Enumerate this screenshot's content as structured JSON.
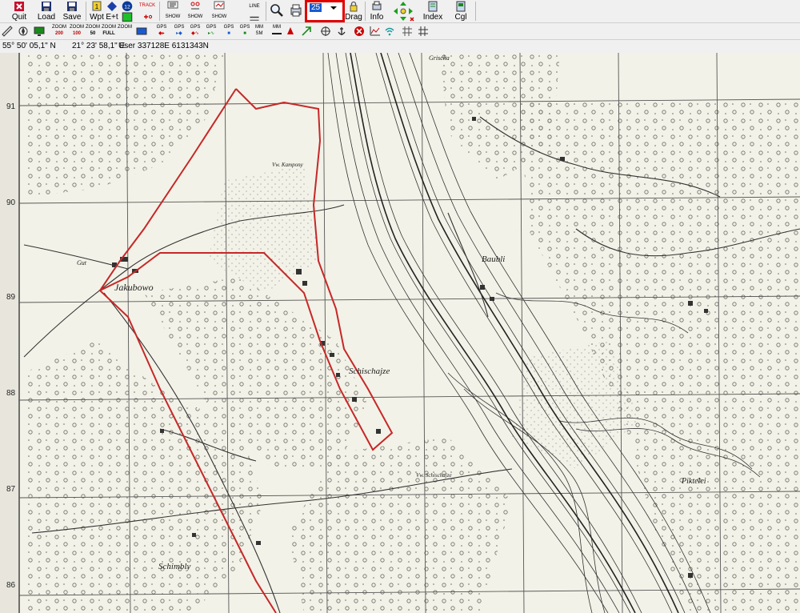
{
  "toolbar": {
    "quit": "Quit",
    "load": "Load",
    "save": "Save",
    "wpt": "Wpt",
    "ent": "E+t",
    "track": "TRACK",
    "show1": "SHOW",
    "show2": "SHOW",
    "show3": "SHOW",
    "line": "LINE",
    "drag": "Drag",
    "info": "Info",
    "index": "Index",
    "cgl": "Cgl",
    "badge12": "12",
    "badge1": "1",
    "zoom_value": "25"
  },
  "toolbar2": {
    "zoom200": [
      "ZOOM",
      "200"
    ],
    "zoom100": [
      "ZOOM",
      "100"
    ],
    "zoom50": [
      "ZOOM",
      "50"
    ],
    "zoomfull": [
      "ZOOM",
      "FULL"
    ],
    "zoom4": [
      "ZOOM",
      ""
    ],
    "gps": "GPS",
    "mm": "MM",
    "sm": "SM"
  },
  "status": {
    "lat": "55° 50' 05,1\" N",
    "lon": "21° 23' 58,1\" E",
    "user": "User  337128E   6131343N"
  },
  "map": {
    "places": {
      "jakubowo": "Jakubowo",
      "schischajze": "Schischajze",
      "baubli": "Baubli",
      "schimbly": "Schimbly",
      "piktelei": "Piktelei",
      "gut": "Gut",
      "vw_schischajze": "Vw. Schischajze",
      "vw_kampony": "Vw. Kampony",
      "grischa": "Grischa"
    },
    "grid": [
      "91",
      "90",
      "89",
      "88",
      "87",
      "86"
    ]
  },
  "colors": {
    "route": "#c62828",
    "highlight": "#e00000",
    "map_bg": "#f3f2e8"
  }
}
